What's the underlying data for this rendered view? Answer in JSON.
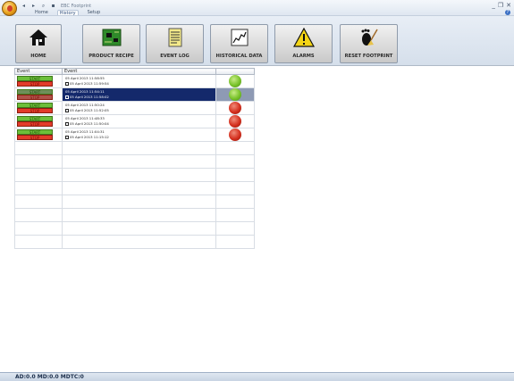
{
  "window": {
    "title": "EBC Footprint",
    "tabs": [
      "Home",
      "History",
      "Setup"
    ],
    "active_tab": "History"
  },
  "ribbon": {
    "buttons": [
      {
        "label": "HOME",
        "icon": "home-icon"
      },
      {
        "label": "PRODUCT RECIPE",
        "icon": "circuit-board-icon"
      },
      {
        "label": "EVENT LOG",
        "icon": "document-icon"
      },
      {
        "label": "HISTORICAL DATA",
        "icon": "chart-icon"
      },
      {
        "label": "ALARMS",
        "icon": "warning-icon"
      },
      {
        "label": "RESET FOOTPRINT",
        "icon": "footprint-broom-icon"
      }
    ]
  },
  "grid": {
    "headers": [
      "Event",
      "Event",
      ""
    ],
    "rows": [
      {
        "start": "START",
        "stop": "STOP",
        "time1": "05 April 2013 11:58:55",
        "time2": "05 April 2013 11:59:54",
        "status": "green",
        "selected": false
      },
      {
        "start": "START",
        "stop": "STOP",
        "time1": "05 April 2013 11:54:11",
        "time2": "05 April 2013 11:58:02",
        "status": "green",
        "selected": true
      },
      {
        "start": "START",
        "stop": "STOP",
        "time1": "05 April 2013 11:50:24",
        "time2": "05 April 2013 11:52:05",
        "status": "red",
        "selected": false
      },
      {
        "start": "START",
        "stop": "STOP",
        "time1": "05 April 2013 11:48:33",
        "time2": "05 April 2013 11:50:04",
        "status": "red",
        "selected": false
      },
      {
        "start": "START",
        "stop": "STOP",
        "time1": "05 April 2013 11:04:31",
        "time2": "05 April 2013 11:15:12",
        "status": "red",
        "selected": false
      }
    ]
  },
  "status": {
    "text": "AD:0.0  MD:0.0  MDTC:0"
  },
  "colors": {
    "selected_row": "#14296b",
    "status_green": "#78c22a",
    "status_red": "#d4301f"
  }
}
